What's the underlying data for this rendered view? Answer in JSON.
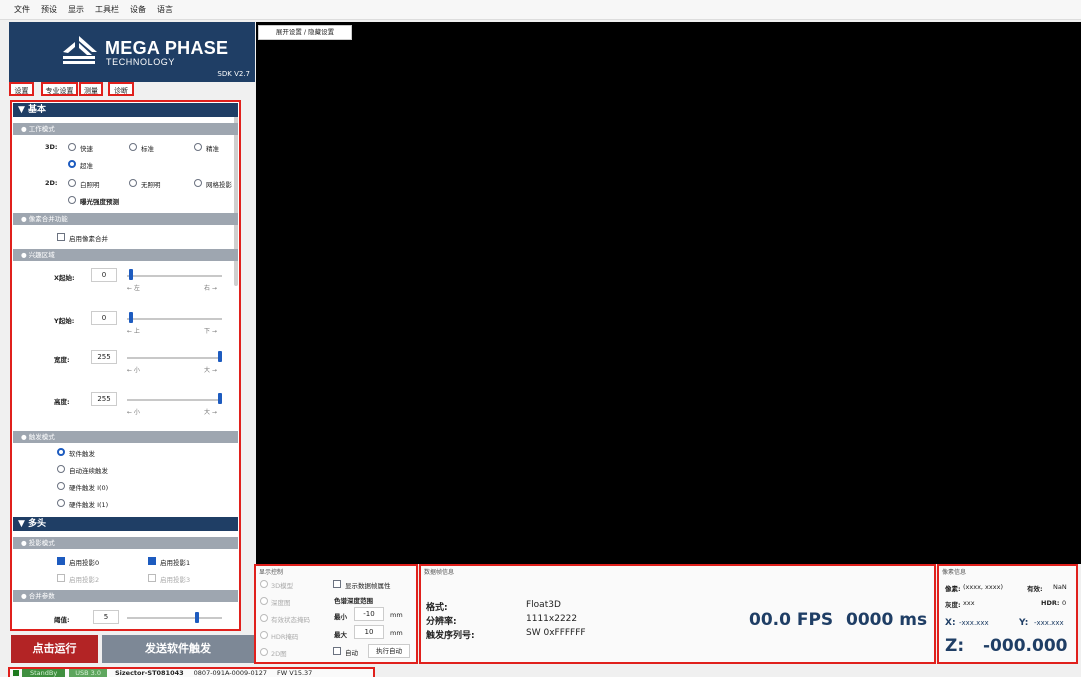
{
  "menu": [
    "文件",
    "预设",
    "显示",
    "工具栏",
    "设备",
    "语言"
  ],
  "brand": {
    "name": "MEGA PHASE",
    "sub": "TECHNOLOGY",
    "sdk": "SDK V2.7"
  },
  "tabs": [
    "设置",
    "专业设置",
    "测量",
    "诊断"
  ],
  "basic": {
    "title": "▼ 基本",
    "work_mode": {
      "title": "● 工作模式",
      "label_3d": "3D:",
      "options_3d": [
        "快速",
        "标准",
        "精准",
        "超准"
      ],
      "selected_3d": "超准",
      "label_2d": "2D:",
      "options_2d": [
        "白照明",
        "无照明",
        "网格投影",
        "曝光强度预测"
      ]
    },
    "binning": {
      "title": "● 像素合并功能",
      "checkbox": "启用像素合并"
    },
    "roi": {
      "title": "● 兴趣区域",
      "rows": [
        {
          "label": "X起始:",
          "value": "0",
          "level": 0.02,
          "left": "← 左",
          "right": "右 →"
        },
        {
          "label": "Y起始:",
          "value": "0",
          "level": 0.02,
          "left": "← 上",
          "right": "下 →"
        },
        {
          "label": "宽度:",
          "value": "255",
          "level": 1.0,
          "left": "← 小",
          "right": "大 →"
        },
        {
          "label": "高度:",
          "value": "255",
          "level": 1.0,
          "left": "← 小",
          "right": "大 →"
        }
      ]
    },
    "trigger_mode": {
      "title": "● 触发模式",
      "options": [
        "软件触发",
        "自动连续触发",
        "硬件触发 I(0)",
        "硬件触发 I(1)"
      ],
      "selected": "软件触发"
    }
  },
  "multihead": {
    "title": "▼ 多头",
    "projector": {
      "title": "● 投影模式",
      "items": [
        {
          "label": "启用投影0",
          "checked": true
        },
        {
          "label": "启用投影1",
          "checked": true
        },
        {
          "label": "启用投影2",
          "checked": false
        },
        {
          "label": "启用投影3",
          "checked": false
        }
      ]
    },
    "merge": {
      "title": "● 合并参数",
      "label": "阈值:",
      "value": "5",
      "level": 0.75
    }
  },
  "buttons": {
    "run": "点击运行",
    "trigger": "发送软件触发"
  },
  "status": {
    "state": "StandBy",
    "usb": "USB 3.0",
    "device": "Sizector-ST081043",
    "serial": "0807-091A-0009-0127",
    "fw": "FW V15.37"
  },
  "viewport": {
    "toggle": "展开设置 / 隐藏设置"
  },
  "display_control": {
    "title": "显示控制",
    "views": [
      "3D模型",
      "深度图",
      "有效状态掩码",
      "HDR掩码",
      "2D图"
    ],
    "show_attr": "显示数据帧属性",
    "depth_range": "色谱深度范围",
    "min_label": "最小",
    "min_value": "-10",
    "max_label": "最大",
    "max_value": "10",
    "unit": "mm",
    "auto": "自动",
    "exec_auto": "执行自动"
  },
  "frame_info": {
    "title": "数据帧信息",
    "format_label": "格式:",
    "format_value": "Float3D",
    "res_label": "分辨率:",
    "res_value": "1111x2222",
    "seq_label": "触发序列号:",
    "seq_value": "SW 0xFFFFFF",
    "fps": "00.0 FPS",
    "ms": "0000 ms"
  },
  "pixel_info": {
    "title": "像素信息",
    "pixel_label": "像素:",
    "pixel_value": "(xxxx, xxxx)",
    "valid_label": "有效:",
    "valid_value": "NaN",
    "gray_label": "灰度:",
    "gray_value": "xxx",
    "hdr_label": "HDR:",
    "hdr_value": "0",
    "x_label": "X:",
    "x_value": "-xxx.xxx",
    "y_label": "Y:",
    "y_value": "-xxx.xxx",
    "z_label": "Z:",
    "z_value": "-000.000"
  }
}
